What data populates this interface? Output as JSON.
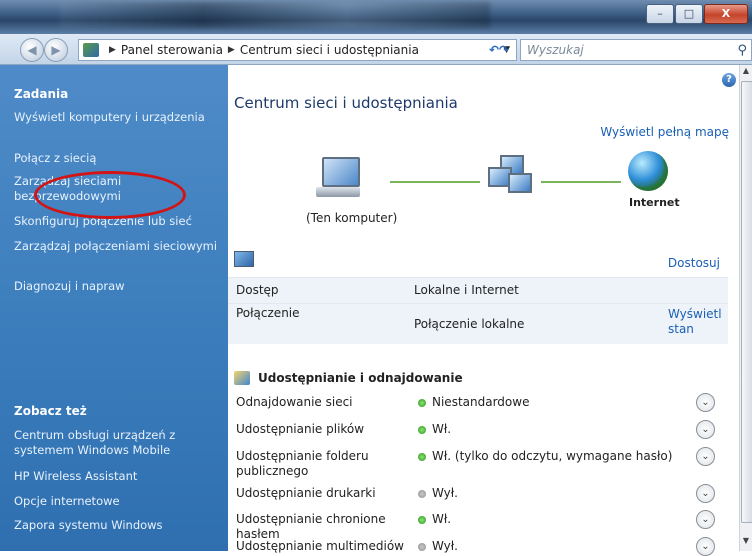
{
  "window": {
    "min": "–",
    "max": "□",
    "close": "X"
  },
  "address": {
    "breadcrumbs": [
      "Panel sterowania",
      "Centrum sieci i udostępniania"
    ],
    "search_placeholder": "Wyszukaj"
  },
  "sidebar": {
    "tasks_heading": "Zadania",
    "tasks": [
      "Wyświetl komputery i urządzenia",
      "Połącz z siecią",
      "Zarządzaj sieciami bezprzewodowymi",
      "Skonfiguruj połączenie lub sieć",
      "Zarządzaj połączeniami sieciowymi",
      "Diagnozuj i napraw"
    ],
    "see_also_heading": "Zobacz też",
    "see_also": [
      "Centrum obsługi urządzeń z systemem Windows Mobile",
      "HP Wireless Assistant",
      "Opcje internetowe",
      "Zapora systemu Windows"
    ]
  },
  "main": {
    "title": "Centrum sieci i udostępniania",
    "full_map_link": "Wyświetl pełną mapę",
    "this_computer": "(Ten komputer)",
    "internet": "Internet",
    "customize": "Dostosuj",
    "access_label": "Dostęp",
    "access_value": "Lokalne i Internet",
    "connection_label": "Połączenie",
    "connection_value": "Połączenie lokalne",
    "view_status": "Wyświetl stan",
    "sharing_heading": "Udostępnianie i odnajdowanie",
    "sharing": [
      {
        "label": "Odnajdowanie sieci",
        "value": "Niestandardowe",
        "on": true
      },
      {
        "label": "Udostępnianie plików",
        "value": "Wł.",
        "on": true
      },
      {
        "label": "Udostępnianie folderu publicznego",
        "value": "Wł. (tylko do odczytu, wymagane hasło)",
        "on": true
      },
      {
        "label": "Udostępnianie drukarki",
        "value": "Wył.",
        "on": false
      },
      {
        "label": "Udostępnianie chronione hasłem",
        "value": "Wł.",
        "on": true
      },
      {
        "label": "Udostępnianie multimediów",
        "value": "Wył.",
        "on": false
      }
    ]
  }
}
